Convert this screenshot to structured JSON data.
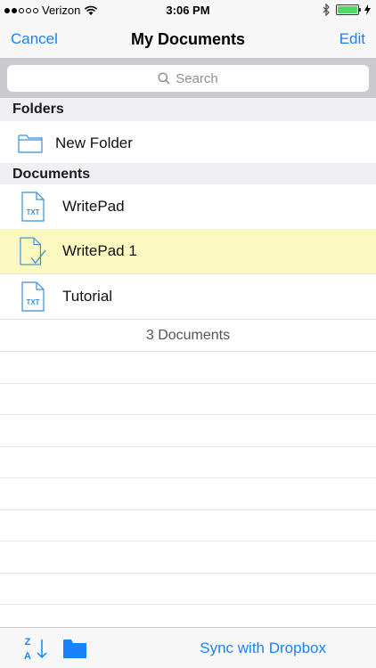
{
  "status_bar": {
    "carrier": "Verizon",
    "time": "3:06 PM",
    "signal_bars_filled": 2,
    "signal_bars_total": 5
  },
  "nav": {
    "cancel_label": "Cancel",
    "title": "My Documents",
    "edit_label": "Edit"
  },
  "search": {
    "placeholder": "Search"
  },
  "folders": {
    "header": "Folders",
    "items": [
      {
        "label": "New Folder",
        "icon": "folder-icon"
      }
    ]
  },
  "documents": {
    "header": "Documents",
    "items": [
      {
        "label": "WritePad",
        "icon": "txt-file-icon",
        "badge": "TXT",
        "selected": false
      },
      {
        "label": "WritePad 1",
        "icon": "checked-file-icon",
        "selected": true
      },
      {
        "label": "Tutorial",
        "icon": "txt-file-icon",
        "badge": "TXT",
        "selected": false
      }
    ],
    "count_label": "3 Documents"
  },
  "toolbar": {
    "sort_top_letter": "Z",
    "sort_bottom_letter": "A",
    "sync_label": "Sync with Dropbox"
  },
  "colors": {
    "accent": "#1a82fb",
    "selected_row": "#fbf9c0",
    "battery": "#4cd964"
  }
}
